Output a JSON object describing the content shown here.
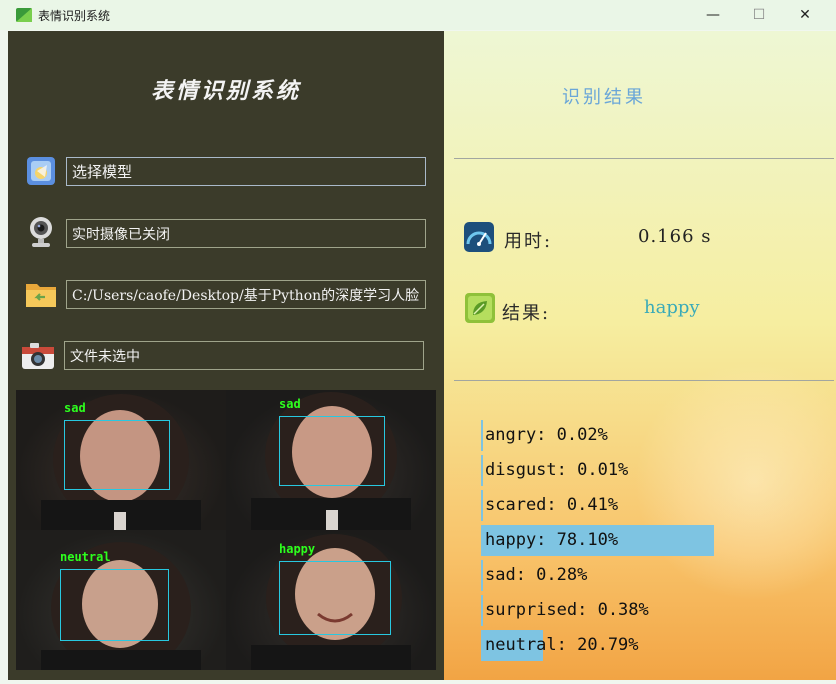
{
  "window": {
    "title": "表情识别系统",
    "minimize": "—",
    "maximize": "☐",
    "close": "✕"
  },
  "left": {
    "app_title": "表情识别系统",
    "model_field": "选择模型",
    "camera_field": "实时摄像已关闭",
    "path_field": "C:/Users/caofe/Desktop/基于Python的深度学习人脸",
    "file_field": "文件未选中"
  },
  "faces": [
    {
      "label": "sad"
    },
    {
      "label": "sad"
    },
    {
      "label": "neutral"
    },
    {
      "label": "happy"
    }
  ],
  "right": {
    "result_title": "识别结果",
    "time_label": "用时:",
    "time_value": "0.166  s",
    "result_label": "结果:",
    "result_value": "happy"
  },
  "probabilities": [
    {
      "text": "angry: 0.02%",
      "value": 0.02
    },
    {
      "text": "disgust: 0.01%",
      "value": 0.01
    },
    {
      "text": "scared: 0.41%",
      "value": 0.41
    },
    {
      "text": "happy: 78.10%",
      "value": 78.1
    },
    {
      "text": "sad: 0.28%",
      "value": 0.28
    },
    {
      "text": "surprised: 0.38%",
      "value": 0.38
    },
    {
      "text": "neutral: 20.79%",
      "value": 20.79
    }
  ],
  "colors": {
    "bar": "#7ec4e2",
    "face_label": "#2dff1e",
    "face_box": "#28c8e0",
    "left_panel": "#3b3b2a"
  }
}
